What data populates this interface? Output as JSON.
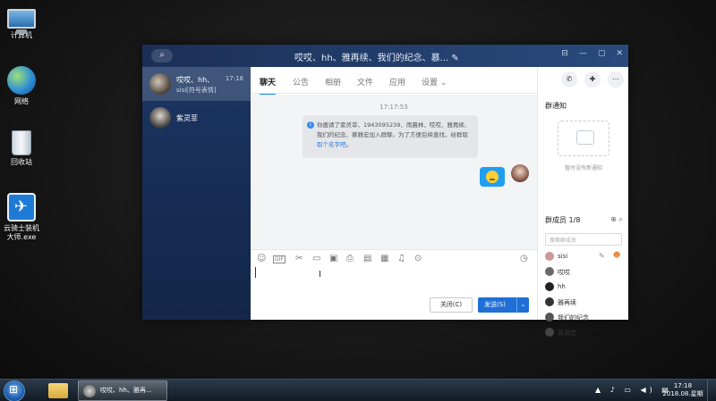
{
  "desktop": {
    "icons": [
      {
        "label": "计算机",
        "icon": "computer-icon"
      },
      {
        "label": "网络",
        "icon": "network-icon"
      },
      {
        "label": "回收站",
        "icon": "recycle-bin-icon"
      },
      {
        "label": "云骑士装机大师.exe",
        "icon": "yunqishi-app-icon"
      }
    ]
  },
  "window": {
    "title": "哎哎、hh、雅再续、我们的纪念、慕... ✎",
    "controls": [
      "⊟",
      "—",
      "▢",
      "✕"
    ]
  },
  "sidebar": {
    "conversations": [
      {
        "name": "哎哎、hh、",
        "sub": "sisi[符号表情]",
        "time": "17:18",
        "active": true
      },
      {
        "name": "紫灵菲",
        "sub": "",
        "time": "",
        "active": false
      }
    ]
  },
  "tabs": [
    "聊天",
    "公告",
    "相册",
    "文件",
    "应用",
    "设置 ⌄"
  ],
  "chat": {
    "time": "17:17:53",
    "notice_text": "你邀请了紫灵菲、1943095239、雨晨林、哎哎、雅再续、我们的纪念、慕雅宏加入群聊。为了方便后续查找，给群取",
    "notice_link": "取个名字吧",
    "notice_end": "。"
  },
  "toolbar": {
    "icons": [
      "emoji-icon",
      "gif-icon",
      "scissors-icon",
      "folder-icon",
      "image-icon",
      "shake-icon",
      "gift-icon",
      "calendar-icon",
      "bell-icon",
      "more-icon",
      "history-icon"
    ],
    "gif_label": "GIF"
  },
  "buttons": {
    "close": "关闭(C)",
    "send": "发送(S)",
    "send_dropdown": "⌄"
  },
  "right_panel": {
    "group_notice_title": "群通知",
    "group_notice_empty": "暂时没有新通知",
    "members_title": "群成员 1/8",
    "member_search_placeholder": "搜索群成员",
    "members": [
      "sisi",
      "哎哎",
      "hh",
      "雅再续",
      "我们的纪念",
      "慕雅宏"
    ]
  },
  "taskbar": {
    "active_task": "哎哎、hh、雅再...",
    "clock_time": "17:18",
    "clock_date": "2018.08.星期一",
    "tray": "▲ ♪ ▭ ◀) ▤"
  }
}
